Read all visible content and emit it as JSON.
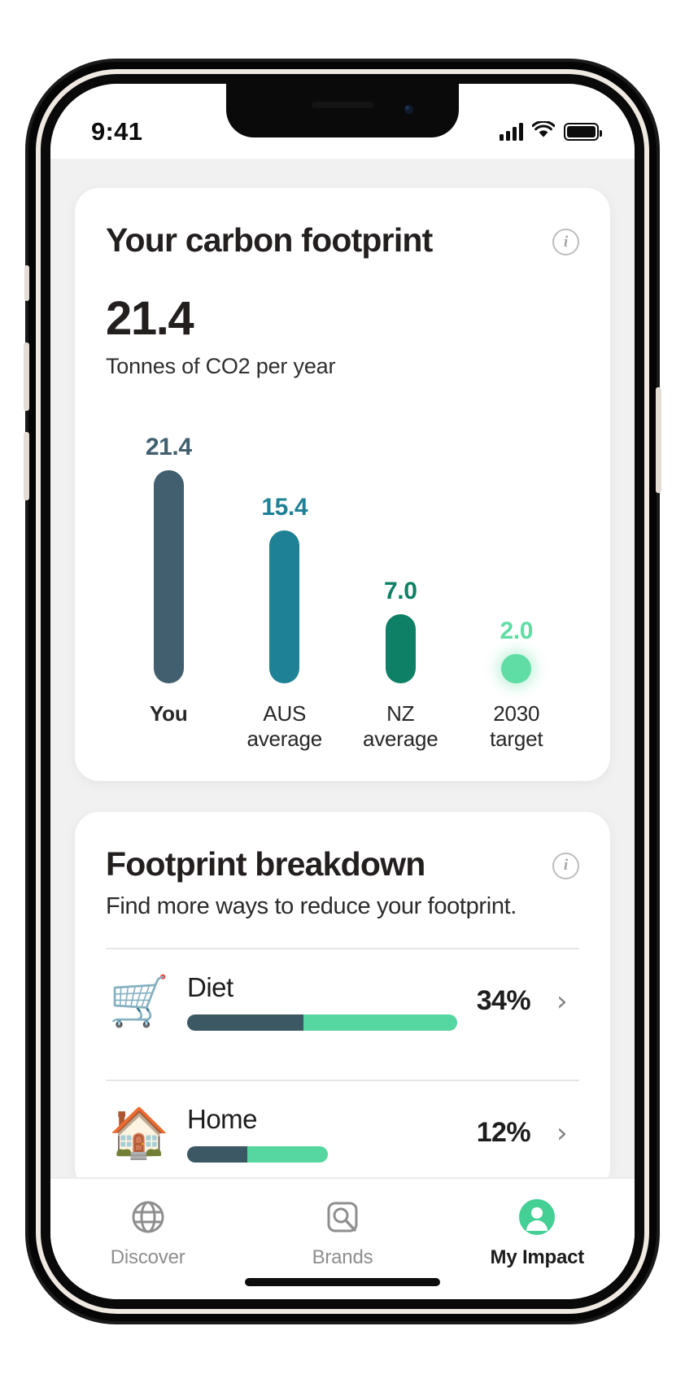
{
  "status_bar": {
    "time": "9:41",
    "signal_icon": "cellular-signal-icon",
    "wifi_icon": "wifi-icon",
    "battery_icon": "battery-icon"
  },
  "footprint_card": {
    "title": "Your carbon footprint",
    "info_icon": "info-icon",
    "info_glyph": "i",
    "total_value": "21.4",
    "total_unit": "Tonnes of CO2 per year"
  },
  "breakdown_card": {
    "title": "Footprint breakdown",
    "subtitle": "Find more ways to reduce your footprint.",
    "info_icon": "info-icon",
    "info_glyph": "i",
    "chevron_glyph": "›",
    "rows": [
      {
        "name": "Diet",
        "emoji": "🛒",
        "emoji_name": "groceries-icon",
        "percent": "34%",
        "fill_ratio": 0.34,
        "bar_width_ratio": 1.0
      },
      {
        "name": "Home",
        "emoji": "🏠",
        "emoji_name": "house-icon",
        "percent": "12%",
        "fill_ratio": 0.34,
        "bar_width_ratio": 0.52
      }
    ]
  },
  "tab_bar": {
    "tabs": [
      {
        "label": "Discover",
        "icon": "globe-icon",
        "active": false
      },
      {
        "label": "Brands",
        "icon": "brand-search-icon",
        "active": false
      },
      {
        "label": "My Impact",
        "icon": "person-avatar-icon",
        "active": true
      }
    ]
  },
  "colors": {
    "you": "#415f6e",
    "aus": "#1e8196",
    "nz": "#0e8065",
    "target": "#5fdda4",
    "accent_mint": "#56d6a0",
    "slate": "#3d5865",
    "text_dark": "#231f1f"
  },
  "chart_data": {
    "type": "bar",
    "title": "Your carbon footprint",
    "xlabel": "",
    "ylabel": "Tonnes of CO2 per year",
    "ylim": [
      0,
      21.4
    ],
    "grid": false,
    "legend": "none",
    "categories": [
      "You",
      "AUS average",
      "NZ average",
      "2030 target"
    ],
    "values": [
      21.4,
      15.4,
      7.0,
      2.0
    ],
    "data_labels": [
      "21.4",
      "15.4",
      "7.0",
      "2.0"
    ],
    "bar_colors": [
      "#415f6e",
      "#1e8196",
      "#0e8065",
      "#5fdda4"
    ],
    "label_lines": [
      [
        "You"
      ],
      [
        "AUS",
        "average"
      ],
      [
        "NZ",
        "average"
      ],
      [
        "2030",
        "target"
      ]
    ],
    "highlighted_category": "You"
  }
}
